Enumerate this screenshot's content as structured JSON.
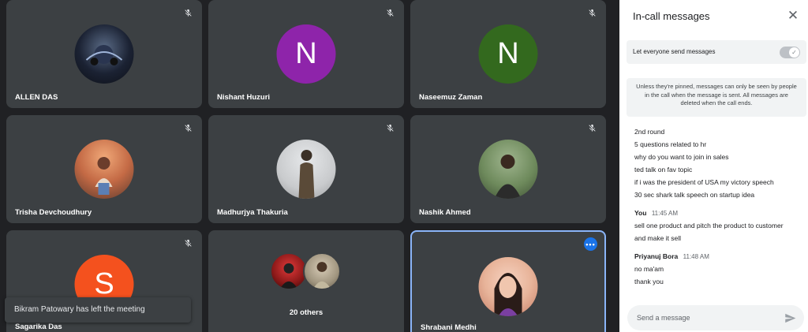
{
  "tiles": [
    {
      "name": "ALLEN DAS",
      "avatar": "photo",
      "muted": true
    },
    {
      "name": "Nishant Huzuri",
      "avatar_letter": "N",
      "avatar_color": "#8e24aa",
      "muted": true
    },
    {
      "name": "Naseemuz Zaman",
      "avatar_letter": "N",
      "avatar_color": "#33691e",
      "muted": true
    },
    {
      "name": "Trisha Devchoudhury",
      "avatar": "photo",
      "muted": true
    },
    {
      "name": "Madhurjya Thakuria",
      "avatar": "photo",
      "muted": true
    },
    {
      "name": "Nashik Ahmed",
      "avatar": "photo",
      "muted": true
    },
    {
      "name": "Sagarika Das",
      "avatar_letter": "S",
      "avatar_color": "#f4511e",
      "muted": true
    },
    {
      "name": "20 others",
      "avatar": "group"
    },
    {
      "name": "Shrabani Medhi",
      "avatar": "photo",
      "active": true
    }
  ],
  "toast": {
    "text": "Bikram Patowary has left the meeting"
  },
  "panel": {
    "title": "In-call messages",
    "toggle_label": "Let everyone send messages",
    "notice": "Unless they're pinned, messages can only be seen by people in the call when the message is sent. All messages are deleted when the call ends.",
    "messages_first": [
      "2nd round",
      "5 questions related to hr",
      "why do you want to join in sales",
      "ted talk on fav topic",
      "if i was the president of USA my victory speech",
      "30 sec shark talk speech on startup idea"
    ],
    "you": {
      "sender": "You",
      "time": "11:45 AM",
      "lines": [
        "sell one product and pitch the product to customer",
        "and make it sell"
      ]
    },
    "other": {
      "sender": "Priyanuj Bora",
      "time": "11:48 AM",
      "lines": [
        "no ma'am",
        "thank you"
      ]
    },
    "input_placeholder": "Send a message"
  },
  "colors": {
    "accent": "#1a73e8",
    "tile_bg": "#3c4043",
    "page_bg": "#202124",
    "active_border": "#8ab4f8"
  },
  "icons": {
    "mic_off": "mic-off-icon",
    "close": "close-icon",
    "send": "send-icon",
    "more": "more-options-icon",
    "check": "check-icon"
  }
}
